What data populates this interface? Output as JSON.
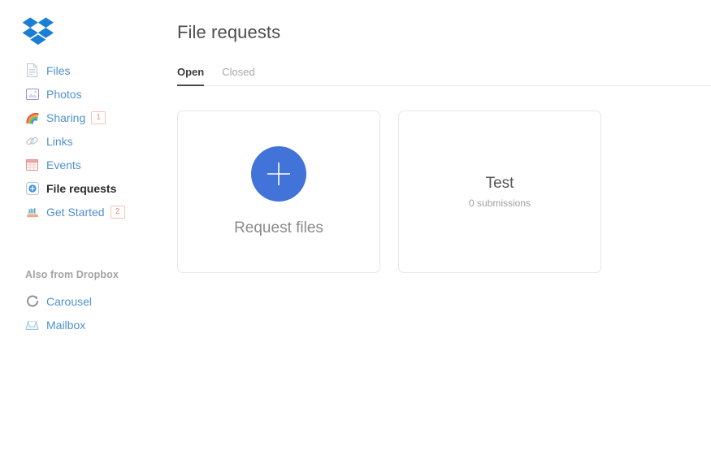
{
  "brand": {
    "logo_icon": "dropbox-logo-icon",
    "logo_color": "#1a7ed6"
  },
  "sidebar": {
    "items": [
      {
        "label": "Files",
        "icon": "document-icon",
        "badge": null,
        "active": false
      },
      {
        "label": "Photos",
        "icon": "photo-icon",
        "badge": null,
        "active": false
      },
      {
        "label": "Sharing",
        "icon": "rainbow-icon",
        "badge": "1",
        "active": false
      },
      {
        "label": "Links",
        "icon": "chain-link-icon",
        "badge": null,
        "active": false
      },
      {
        "label": "Events",
        "icon": "calendar-icon",
        "badge": null,
        "active": false
      },
      {
        "label": "File requests",
        "icon": "file-request-icon",
        "badge": null,
        "active": true
      },
      {
        "label": "Get Started",
        "icon": "get-started-icon",
        "badge": "2",
        "active": false
      }
    ],
    "secondary_heading": "Also from Dropbox",
    "secondary_items": [
      {
        "label": "Carousel",
        "icon": "carousel-icon"
      },
      {
        "label": "Mailbox",
        "icon": "mailbox-icon"
      }
    ]
  },
  "main": {
    "title": "File requests",
    "tabs": [
      {
        "label": "Open",
        "active": true
      },
      {
        "label": "Closed",
        "active": false
      }
    ],
    "cards": [
      {
        "type": "create",
        "icon": "plus-icon",
        "caption": "Request files"
      },
      {
        "type": "request",
        "title": "Test",
        "subtitle": "0 submissions"
      }
    ]
  },
  "colors": {
    "link_blue": "#4f91d0",
    "accent_blue": "#4273d8",
    "badge_text": "#e8907f",
    "badge_border": "#f3c3b8",
    "card_border": "#e6e6e6",
    "divider": "#e8e8e8"
  }
}
